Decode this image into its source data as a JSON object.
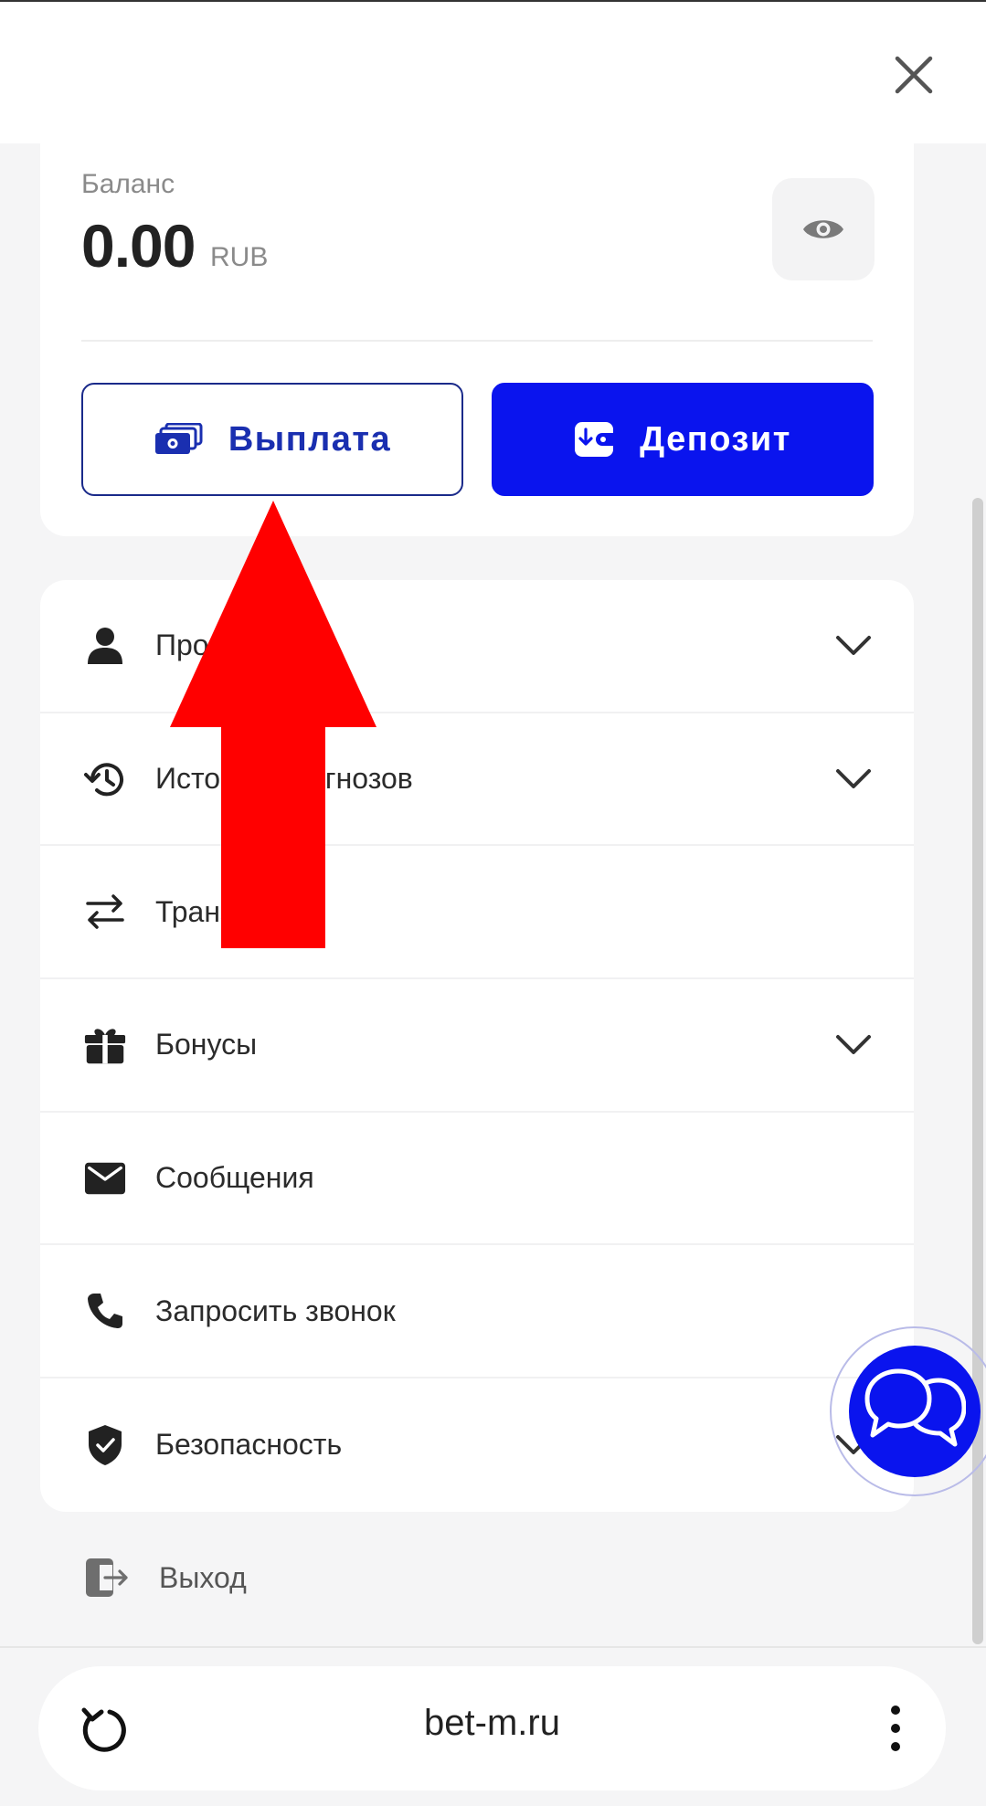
{
  "header": {
    "close_icon": "close-icon"
  },
  "balance": {
    "label": "Баланс",
    "amount": "0.00",
    "currency": "RUB",
    "toggle_icon": "eye-icon"
  },
  "actions": {
    "withdraw_label": "Выплата",
    "withdraw_icon": "cash-stack-icon",
    "deposit_label": "Депозит",
    "deposit_icon": "wallet-icon"
  },
  "menu": {
    "items": [
      {
        "label": "Профиль",
        "icon": "person-icon",
        "expandable": true
      },
      {
        "label": "История прогнозов",
        "icon": "history-icon",
        "expandable": true
      },
      {
        "label": "Транзакции",
        "icon": "swap-arrows-icon",
        "expandable": false
      },
      {
        "label": "Бонусы",
        "icon": "gift-icon",
        "expandable": true
      },
      {
        "label": "Сообщения",
        "icon": "envelope-icon",
        "expandable": false
      },
      {
        "label": "Запросить звонок",
        "icon": "phone-icon",
        "expandable": false
      },
      {
        "label": "Безопасность",
        "icon": "shield-check-icon",
        "expandable": true
      }
    ]
  },
  "exit": {
    "label": "Выход",
    "icon": "logout-icon"
  },
  "browser": {
    "url": "bet-m.ru",
    "reload_icon": "reload-icon",
    "more_icon": "more-vertical-icon"
  },
  "colors": {
    "primary": "#0a14ee",
    "annotation_arrow": "#ff0000"
  }
}
